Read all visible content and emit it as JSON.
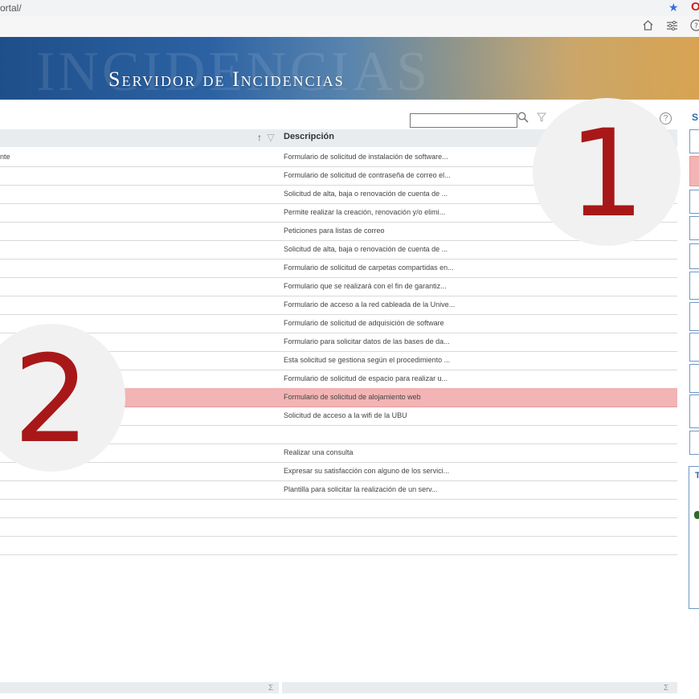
{
  "browser": {
    "url": "ortal/",
    "bookmark_icon": "star-icon",
    "profile_icon": "opera-icon",
    "toolbar_icons": [
      "home-icon",
      "sliders-icon",
      "help-icon"
    ]
  },
  "banner": {
    "title": "Servidor de Incidencias",
    "watermark": "INCIDENCIAS"
  },
  "search": {
    "value": "",
    "placeholder": "",
    "search_icon": "magnifier-icon",
    "filter_icon": "filter-icon",
    "help_icon": "help-icon"
  },
  "table": {
    "header": {
      "sort_indicator": "↑",
      "filter_glyph": "▽",
      "description_label": "Descripción"
    },
    "selected_index": 13,
    "rows": [
      {
        "name": "nte",
        "description": "Formulario de solicitud de instalación de software..."
      },
      {
        "name": "",
        "description": "Formulario de solicitud de contraseña de correo el..."
      },
      {
        "name": "",
        "description": "Solicitud de alta, baja o renovación de cuenta de ..."
      },
      {
        "name": "",
        "description": "Permite realizar la creación, renovación y/o elimi..."
      },
      {
        "name": "",
        "description": "Peticiones para listas de correo"
      },
      {
        "name": "",
        "description": "Solicitud de alta, baja o renovación de cuenta de ..."
      },
      {
        "name": "",
        "description": "Formulario de solicitud de carpetas compartidas en..."
      },
      {
        "name": "",
        "description": "Formulario que se realizará con el fin de garantiz..."
      },
      {
        "name": "",
        "description": "Formulario de acceso a la red cableada de la Unive..."
      },
      {
        "name": "",
        "description": "Formulario de solicitud de adquisición de software"
      },
      {
        "name": "",
        "description": "Formulario para solicitar datos de las bases de da..."
      },
      {
        "name": "",
        "description": "Esta solicitud se gestiona según el procedimiento ..."
      },
      {
        "name": "",
        "description": "Formulario de solicitud de espacio para realizar u..."
      },
      {
        "name": "",
        "description": "Formulario de solicitud de alojamiento web"
      },
      {
        "name": "",
        "description": "Solicitud de acceso a la wifi de la UBU"
      },
      {
        "name": "",
        "description": ""
      },
      {
        "name": "",
        "description": "Realizar una consulta"
      },
      {
        "name": "",
        "description": "Expresar su satisfacción con alguno de los servici..."
      },
      {
        "name": "",
        "description": "Plantilla para solicitar la realización de un serv..."
      },
      {
        "name": "",
        "description": ""
      },
      {
        "name": "",
        "description": ""
      },
      {
        "name": "",
        "description": ""
      }
    ]
  },
  "footer": {
    "sigma": "Σ"
  },
  "right_panel": {
    "header_letter": "S",
    "panel_letter": "T"
  },
  "annotations": [
    {
      "label": "1"
    },
    {
      "label": "2"
    }
  ],
  "colors": {
    "selection": "#f2b4b4",
    "annotation_number": "#a81818",
    "accent_blue": "#2b6cb0"
  }
}
